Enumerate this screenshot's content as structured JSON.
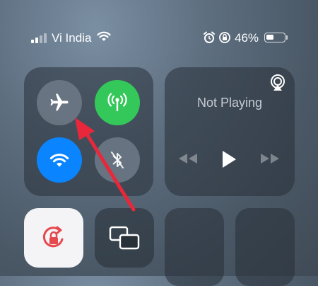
{
  "status_bar": {
    "carrier": "Vi India",
    "battery_percent": "46%",
    "battery_level": 0.46,
    "icons": [
      "signal-icon",
      "wifi-icon",
      "alarm-icon",
      "rotation-lock-icon",
      "battery-icon"
    ]
  },
  "connectivity": {
    "airplane_mode": "off",
    "cellular_data": "on",
    "wifi": "on",
    "bluetooth": "off"
  },
  "media": {
    "status": "Not Playing"
  },
  "controls": {
    "orientation_lock": "on",
    "screen_mirroring": "screen-mirroring-icon"
  },
  "colors": {
    "cellular_green": "#34c759",
    "wifi_blue": "#0a84ff",
    "lock_red": "#e5484d",
    "annotation_arrow": "#e8283a"
  }
}
